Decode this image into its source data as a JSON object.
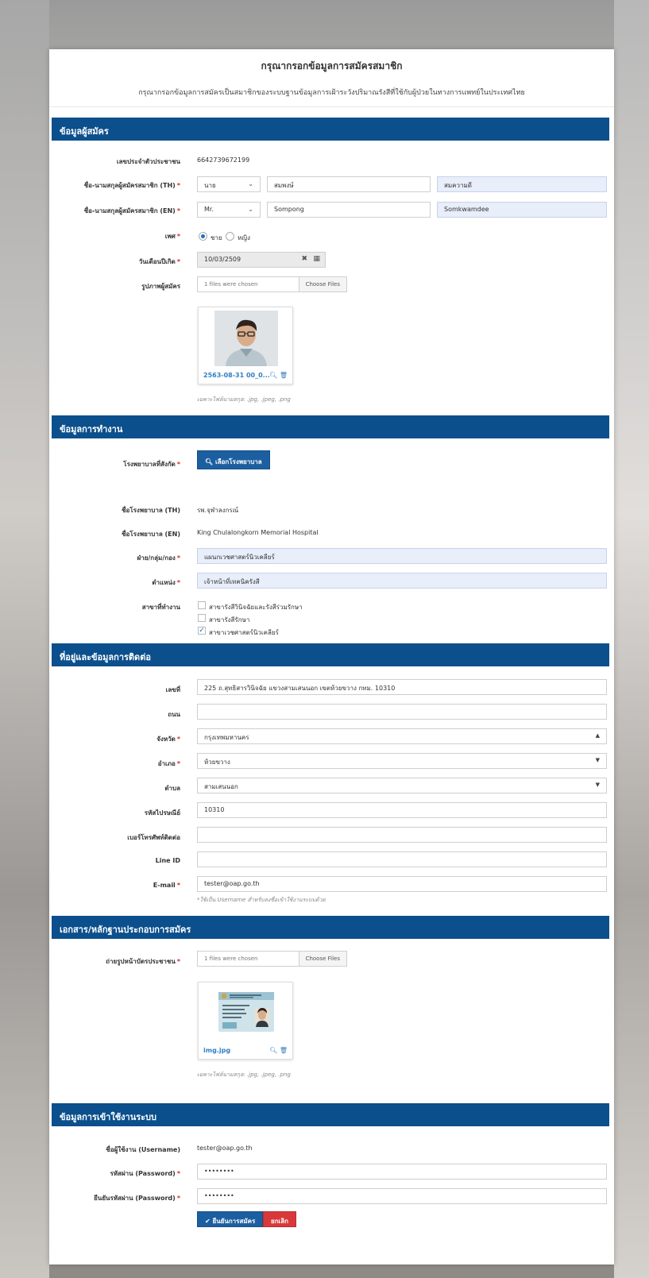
{
  "header": {
    "title": "กรุณากรอกข้อมูลการสมัครสมาชิก",
    "subtitle": "กรุณากรอกข้อมูลการสมัครเป็นสมาชิกของระบบฐานข้อมูลการเฝ้าระวังปริมาณรังสีที่ใช้กับผู้ป่วยในทางการแพทย์ในประเทศไทย"
  },
  "sections": {
    "applicant": "ข้อมูลผู้สมัคร",
    "work": "ข้อมูลการทำงาน",
    "address": "ที่อยู่และข้อมูลการติดต่อ",
    "documents": "เอกสาร/หลักฐานประกอบการสมัคร",
    "account": "ข้อมูลการเข้าใช้งานระบบ"
  },
  "applicant": {
    "id_label": "เลขประจำตัวประชาชน",
    "id_value": "6642739672199",
    "name_th_label": "ชื่อ-นามสกุลผู้สมัครสมาชิก (TH)",
    "title_th": "นาย",
    "first_th": "สมพงษ์",
    "last_th": "สมความดี",
    "name_en_label": "ชื่อ-นามสกุลผู้สมัครสมาชิก (EN)",
    "title_en": "Mr.",
    "first_en": "Sompong",
    "last_en": "Somkwamdee",
    "gender_label": "เพศ",
    "gender_male": "ชาย",
    "gender_female": "หญิง",
    "dob_label": "วันเดือนปีเกิด",
    "dob_value": "10/03/2509",
    "photo_label": "รูปภาพผู้สมัคร",
    "photo_chosen": "1 files were chosen",
    "choose_files": "Choose Files",
    "photo_filename": "2563-08-31 00_0...",
    "photo_hint": "เฉพาะไฟล์นามสกุล: .jpg, .jpeg, .png"
  },
  "work": {
    "hospital_label": "โรงพยาบาลที่สังกัด",
    "hospital_button": "เลือกโรงพยาบาล",
    "hospital_th_label": "ชื่อโรงพยาบาล (TH)",
    "hospital_th_value": "รพ.จุฬาลงกรณ์",
    "hospital_en_label": "ชื่อโรงพยาบาล (EN)",
    "hospital_en_value": "King Chulalongkorn Memorial Hospital",
    "dept_label": "ฝ่าย/กลุ่ม/กอง",
    "dept_value": "แผนกเวชศาสตร์นิวเคลียร์",
    "position_label": "ตำแหน่ง",
    "position_value": "เจ้าหน้าที่เทคนิครังสี",
    "branch_label": "สาขาที่ทำงาน",
    "branches": [
      "สาขารังสีวินิจฉัยและรังสีร่วมรักษา",
      "สาขารังสีรักษา",
      "สาขาเวชศาสตร์นิวเคลียร์"
    ]
  },
  "address": {
    "no_label": "เลขที่",
    "no_value": "225 ถ.สุทธิสารวินิจฉัย แขวงสามเสนนอก เขตห้วยขวาง กทม. 10310",
    "road_label": "ถนน",
    "road_value": "",
    "province_label": "จังหวัด",
    "province_value": "กรุงเทพมหานคร",
    "district_label": "อำเภอ",
    "district_value": "ห้วยขวาง",
    "subdistrict_label": "ตำบล",
    "subdistrict_value": "สามเสนนอก",
    "postcode_label": "รหัสไปรษณีย์",
    "postcode_value": "10310",
    "phone_label": "เบอร์โทรศัพท์ติดต่อ",
    "phone_value": "",
    "line_label": "Line ID",
    "line_value": "",
    "email_label": "E-mail",
    "email_value": "tester@oap.go.th",
    "email_hint": "*ใช้เป็น Username สำหรับลงชื่อเข้าใช้งานระบบด้วย"
  },
  "documents": {
    "idcard_label": "ถ่ายรูปหน้าบัตรประชาชน",
    "chosen": "1 files were chosen",
    "choose_files": "Choose Files",
    "filename": "img.jpg",
    "hint": "เฉพาะไฟล์นามสกุล: .jpg, .jpeg, .png"
  },
  "account": {
    "username_label": "ชื่อผู้ใช้งาน (Username)",
    "username_value": "tester@oap.go.th",
    "password_label": "รหัสผ่าน (Password)",
    "password_value": "••••••••",
    "confirm_label": "ยืนยันรหัสผ่าน (Password)",
    "confirm_value": "••••••••",
    "submit": "ยืนยันการสมัคร",
    "cancel": "ยกเลิก"
  }
}
